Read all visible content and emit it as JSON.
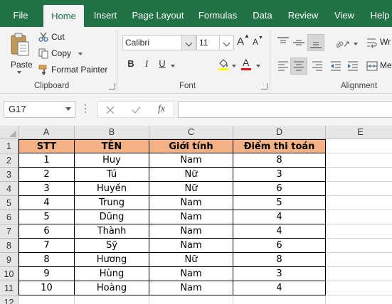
{
  "tabs": [
    "File",
    "Home",
    "Insert",
    "Page Layout",
    "Formulas",
    "Data",
    "Review",
    "View",
    "Help"
  ],
  "active_tab": "Home",
  "ribbon": {
    "clipboard": {
      "paste_label": "Paste",
      "cut_label": "Cut",
      "copy_label": "Copy",
      "format_painter_label": "Format Painter",
      "group_label": "Clipboard"
    },
    "font": {
      "font_name": "Calibri",
      "font_size": "11",
      "grow_label": "A",
      "shrink_label": "A",
      "bold_label": "B",
      "italic_label": "I",
      "underline_label": "U",
      "font_color_label": "A",
      "group_label": "Font"
    },
    "alignment": {
      "wrap_label": "Wr",
      "merge_label": "Me",
      "group_label": "Alignment"
    }
  },
  "formula_bar": {
    "name_box": "G17",
    "fx_label": "fx",
    "formula": ""
  },
  "columns": [
    "A",
    "B",
    "C",
    "D",
    "E"
  ],
  "rows": [
    "1",
    "2",
    "3",
    "4",
    "5",
    "6",
    "7",
    "8",
    "9",
    "10",
    "11",
    "12"
  ],
  "table": {
    "headers": [
      "STT",
      "TÊN",
      "Giới tính",
      "Điểm thi toán"
    ],
    "rows": [
      [
        "1",
        "Huy",
        "Nam",
        "8"
      ],
      [
        "2",
        "Tú",
        "Nữ",
        "3"
      ],
      [
        "3",
        "Huyền",
        "Nữ",
        "6"
      ],
      [
        "4",
        "Trung",
        "Nam",
        "5"
      ],
      [
        "5",
        "Dũng",
        "Nam",
        "4"
      ],
      [
        "6",
        "Thành",
        "Nam",
        "4"
      ],
      [
        "7",
        "Sỹ",
        "Nam",
        "6"
      ],
      [
        "8",
        "Hương",
        "Nữ",
        "8"
      ],
      [
        "9",
        "Hùng",
        "Nam",
        "3"
      ],
      [
        "10",
        "Hoàng",
        "Nam",
        "4"
      ]
    ]
  },
  "colors": {
    "excel_green": "#217346",
    "header_fill": "#f4b183",
    "font_color_bar": "#e81123"
  }
}
